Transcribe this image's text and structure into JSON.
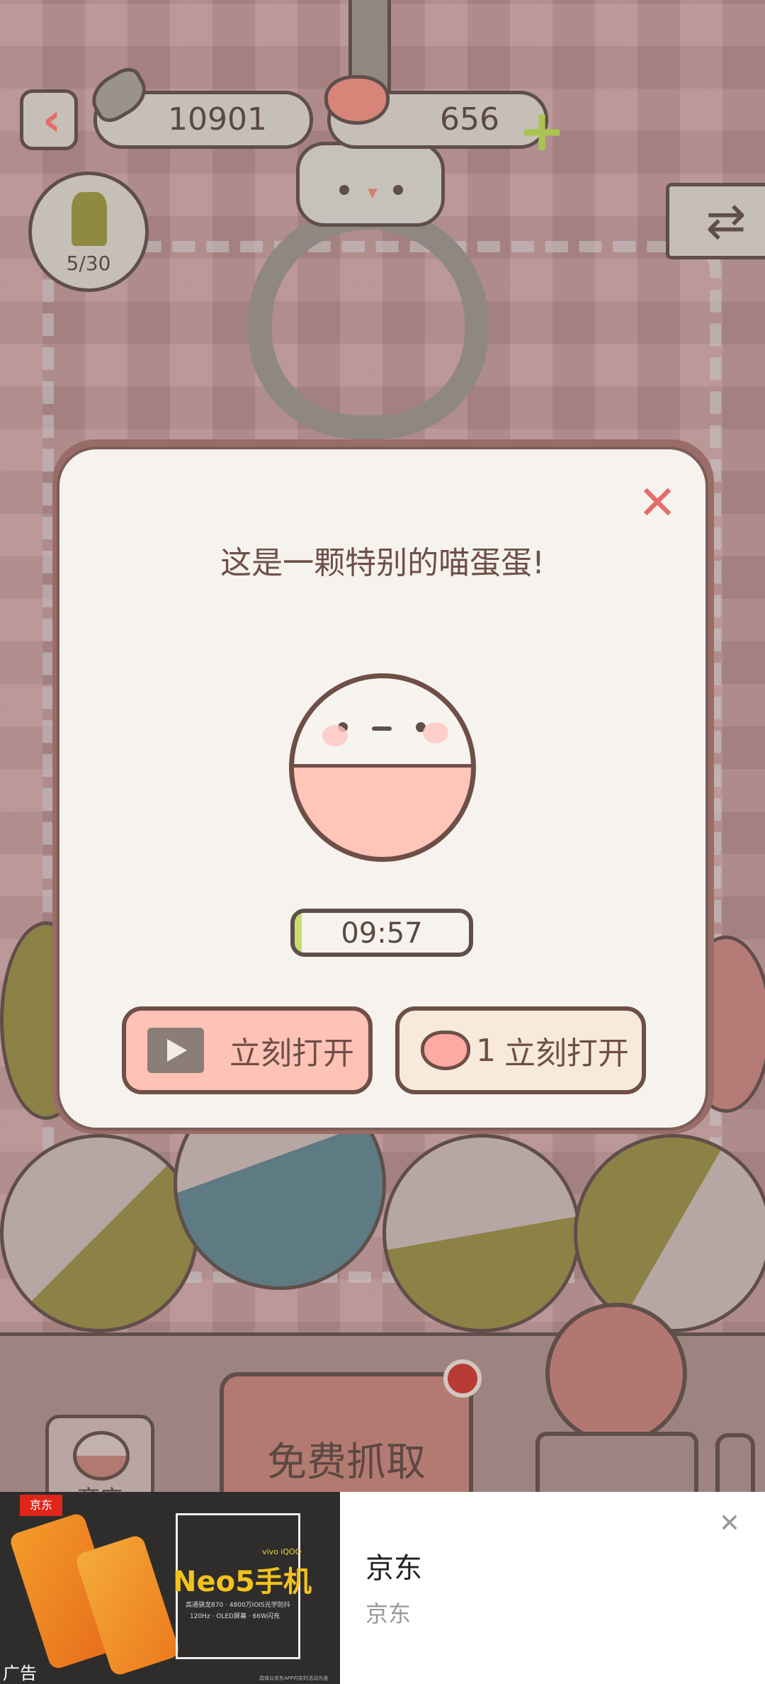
{
  "hud": {
    "fish_count": "10901",
    "heart_count": "656",
    "plant_progress": "5/30"
  },
  "modal": {
    "title": "这是一颗特别的喵蛋蛋!",
    "timer": "09:57",
    "timer_progress_percent": 4,
    "video_open_label": "立刻打开",
    "heart_cost": "1",
    "heart_open_label": "立刻打开"
  },
  "bottom": {
    "free_grab_label": "免费抓取",
    "shop_label": "商店"
  },
  "ad": {
    "badge": "京东",
    "headline": "Neo5手机",
    "brand_small": "vivo iQOO",
    "spec_line1": "高通骁龙870 · 4800万IOIS光学防抖",
    "spec_line2": "120Hz · OLED屏幕 · 66W闪充",
    "disclaimer": "具体以京东APP内实时活动为准",
    "title": "京东",
    "subtitle": "京东",
    "ad_label": "广告"
  },
  "colors": {
    "accent_red": "#e56c6b",
    "pink": "#ffc2b6",
    "outline": "#5f4e4a",
    "progress_green": "#c5de6d"
  }
}
